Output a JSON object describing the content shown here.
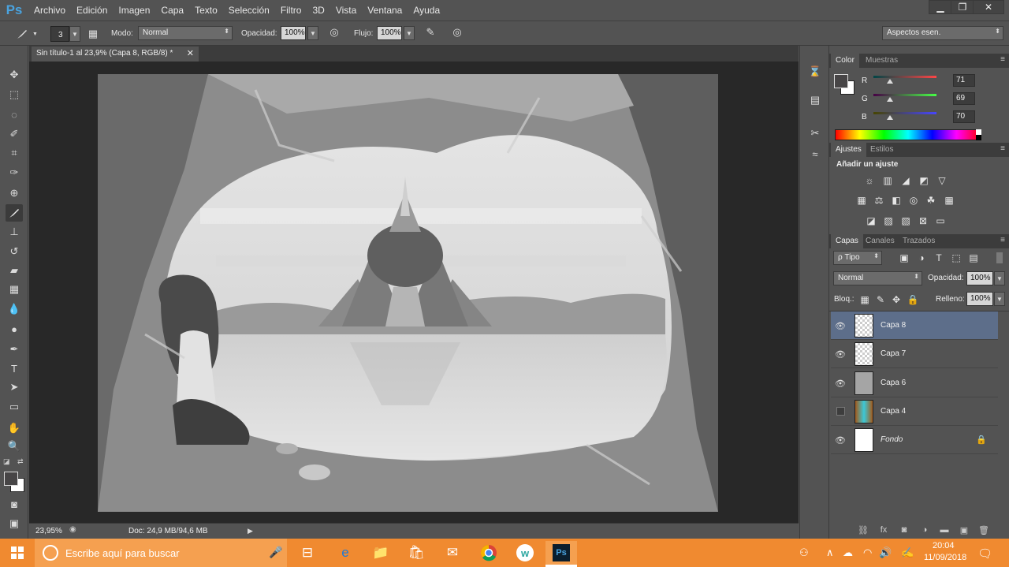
{
  "app": {
    "logo": "Ps"
  },
  "menu": [
    "Archivo",
    "Edición",
    "Imagen",
    "Capa",
    "Texto",
    "Selección",
    "Filtro",
    "3D",
    "Vista",
    "Ventana",
    "Ayuda"
  ],
  "window_controls": {
    "minimize": "▁",
    "restore": "❐",
    "close": "✕"
  },
  "options_bar": {
    "brush_size": "3",
    "mode_label": "Modo:",
    "mode_value": "Normal",
    "opacity_label": "Opacidad:",
    "opacity_value": "100%",
    "flow_label": "Flujo:",
    "flow_value": "100%",
    "workspace_value": "Aspectos esen."
  },
  "document": {
    "tab_title": "Sin título-1 al 23,9% (Capa 8, RGB/8) *",
    "zoom": "23,95%",
    "doc_size": "Doc: 24,9 MB/94,6 MB"
  },
  "color_panel": {
    "tabs": [
      "Color",
      "Muestras"
    ],
    "r_label": "R",
    "r_value": "71",
    "g_label": "G",
    "g_value": "69",
    "b_label": "B",
    "b_value": "70",
    "foreground_color": "#474546"
  },
  "adjust_panel": {
    "tabs": [
      "Ajustes",
      "Estilos"
    ],
    "heading": "Añadir un ajuste"
  },
  "layers_panel": {
    "tabs": [
      "Capas",
      "Canales",
      "Trazados"
    ],
    "filter_label": "ρ Tipo",
    "blend_mode": "Normal",
    "opacity_label": "Opacidad:",
    "opacity_value": "100%",
    "lock_label": "Bloq.:",
    "fill_label": "Relleno:",
    "fill_value": "100%",
    "layers": [
      {
        "name": "Capa 8",
        "visible": true,
        "selected": true
      },
      {
        "name": "Capa 7",
        "visible": true,
        "selected": false
      },
      {
        "name": "Capa 6",
        "visible": true,
        "selected": false
      },
      {
        "name": "Capa 4",
        "visible": false,
        "selected": false
      },
      {
        "name": "Fondo",
        "visible": true,
        "selected": false,
        "locked": true
      }
    ]
  },
  "taskbar": {
    "search_placeholder": "Escribe aquí para buscar",
    "time": "20:04",
    "date": "11/09/2018",
    "accent": "#f08a30"
  }
}
